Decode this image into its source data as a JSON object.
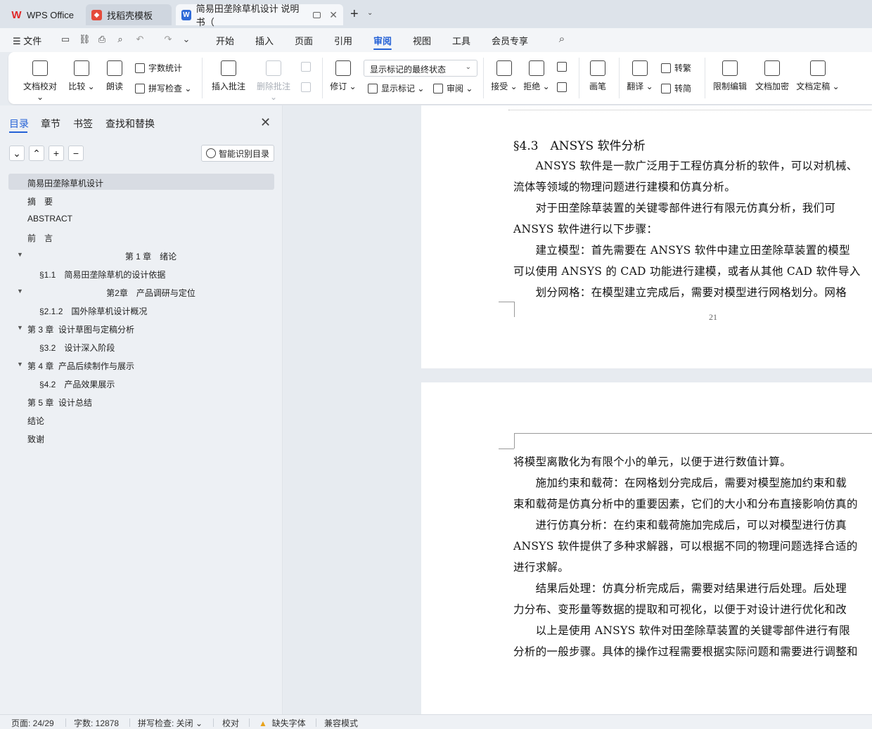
{
  "tabs": [
    {
      "label": "WPS Office"
    },
    {
      "label": "找稻壳模板"
    },
    {
      "label": "简易田垄除草机设计 说明书（"
    }
  ],
  "menu": {
    "file": "文件",
    "items": [
      "开始",
      "插入",
      "页面",
      "引用",
      "审阅",
      "视图",
      "工具",
      "会员专享"
    ],
    "active": "审阅"
  },
  "ribbon": {
    "doc_check": "文档校对",
    "compare": "比较",
    "read_aloud": "朗读",
    "word_count": "字数统计",
    "spell_check": "拼写检查",
    "insert_comment": "插入批注",
    "delete_comment": "删除批注",
    "revise": "修订",
    "markup_state": "显示标记的最终状态",
    "show_markup": "显示标记",
    "review": "审阅",
    "accept": "接受",
    "reject": "拒绝",
    "pen": "画笔",
    "translate": "翻译",
    "to_traditional": "转繁",
    "to_simplified": "转简",
    "restrict_edit": "限制编辑",
    "encrypt": "文档加密",
    "finalize": "文档定稿"
  },
  "panel": {
    "tabs": [
      "目录",
      "章节",
      "书签",
      "查找和替换"
    ],
    "smart_toc": "智能识别目录",
    "toc": [
      {
        "text": "简易田垄除草机设计",
        "level": 0,
        "arrow": false
      },
      {
        "text": "摘　要",
        "level": 0,
        "arrow": false
      },
      {
        "text": "ABSTRACT",
        "level": 0,
        "arrow": false
      },
      {
        "text": "前　言",
        "level": 0,
        "arrow": false
      },
      {
        "text": "第 1 章　绪论",
        "level": 0,
        "arrow": true,
        "center": true
      },
      {
        "text": "§1.1　简易田垄除草机的设计依据",
        "level": 1,
        "arrow": false
      },
      {
        "text": "第2章　产品调研与定位",
        "level": 0,
        "arrow": true,
        "center": true
      },
      {
        "text": "§2.1.2　国外除草机设计概况",
        "level": 1,
        "arrow": false
      },
      {
        "text": "第 3 章  设计草图与定稿分析",
        "level": 0,
        "arrow": true
      },
      {
        "text": "§3.2　设计深入阶段",
        "level": 1,
        "arrow": false
      },
      {
        "text": "第 4 章  产品后续制作与展示",
        "level": 0,
        "arrow": true
      },
      {
        "text": "§4.2　产品效果展示",
        "level": 1,
        "arrow": false
      },
      {
        "text": "第 5 章  设计总结",
        "level": 0,
        "arrow": false
      },
      {
        "text": "结论",
        "level": 0,
        "arrow": false
      },
      {
        "text": "致谢",
        "level": 0,
        "arrow": false
      }
    ]
  },
  "document": {
    "heading": "§4.3　ANSYS 软件分析",
    "page1_lines": [
      "　　ANSYS 软件是一款广泛用于工程仿真分析的软件，可以对机械、",
      "流体等领域的物理问题进行建模和仿真分析。",
      "　　对于田垄除草装置的关键零部件进行有限元仿真分析，我们可",
      "ANSYS 软件进行以下步骤：",
      "　　建立模型：首先需要在 ANSYS 软件中建立田垄除草装置的模型",
      "可以使用 ANSYS 的 CAD 功能进行建模，或者从其他 CAD 软件导入",
      "　　划分网格：在模型建立完成后，需要对模型进行网格划分。网格"
    ],
    "page_number": "21",
    "page2_lines": [
      "将模型离散化为有限个小的单元，以便于进行数值计算。",
      "　　施加约束和载荷：在网格划分完成后，需要对模型施加约束和载",
      "束和载荷是仿真分析中的重要因素，它们的大小和分布直接影响仿真的",
      "　　进行仿真分析：在约束和载荷施加完成后，可以对模型进行仿真",
      "ANSYS 软件提供了多种求解器，可以根据不同的物理问题选择合适的",
      "进行求解。",
      "　　结果后处理：仿真分析完成后，需要对结果进行后处理。后处理",
      "力分布、变形量等数据的提取和可视化，以便于对设计进行优化和改",
      "　　以上是使用 ANSYS 软件对田垄除草装置的关键零部件进行有限",
      "分析的一般步骤。具体的操作过程需要根据实际问题和需要进行调整和"
    ]
  },
  "status": {
    "page": "页面: 24/29",
    "words": "字数: 12878",
    "spell": "拼写检查: 关闭",
    "proof": "校对",
    "missing_font": "缺失字体",
    "compat": "兼容模式"
  },
  "colors": {
    "accent": "#2461d6",
    "warning": "#e8a21a"
  }
}
